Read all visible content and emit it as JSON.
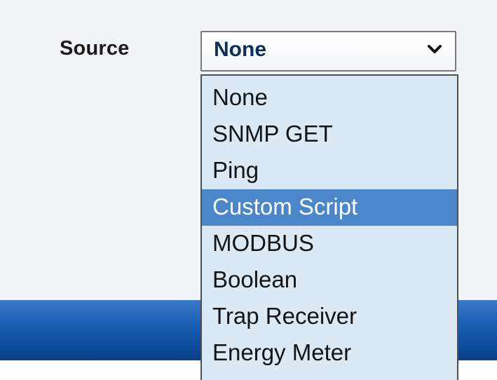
{
  "form": {
    "source_label": "Source"
  },
  "source_select": {
    "selected_value": "None",
    "highlighted_option": "Custom Script",
    "options": [
      {
        "label": "None"
      },
      {
        "label": "SNMP GET"
      },
      {
        "label": "Ping"
      },
      {
        "label": "Custom Script"
      },
      {
        "label": "MODBUS"
      },
      {
        "label": "Boolean"
      },
      {
        "label": "Trap Receiver"
      },
      {
        "label": "Energy Meter"
      }
    ]
  },
  "icons": {
    "dropdown_arrow": "chevron-down-icon"
  },
  "colors": {
    "highlight": "#4a86c8",
    "dropdown_background": "#dbe9f5",
    "selected_text": "#0e2f57",
    "bar_blue": "#1e63b8"
  }
}
